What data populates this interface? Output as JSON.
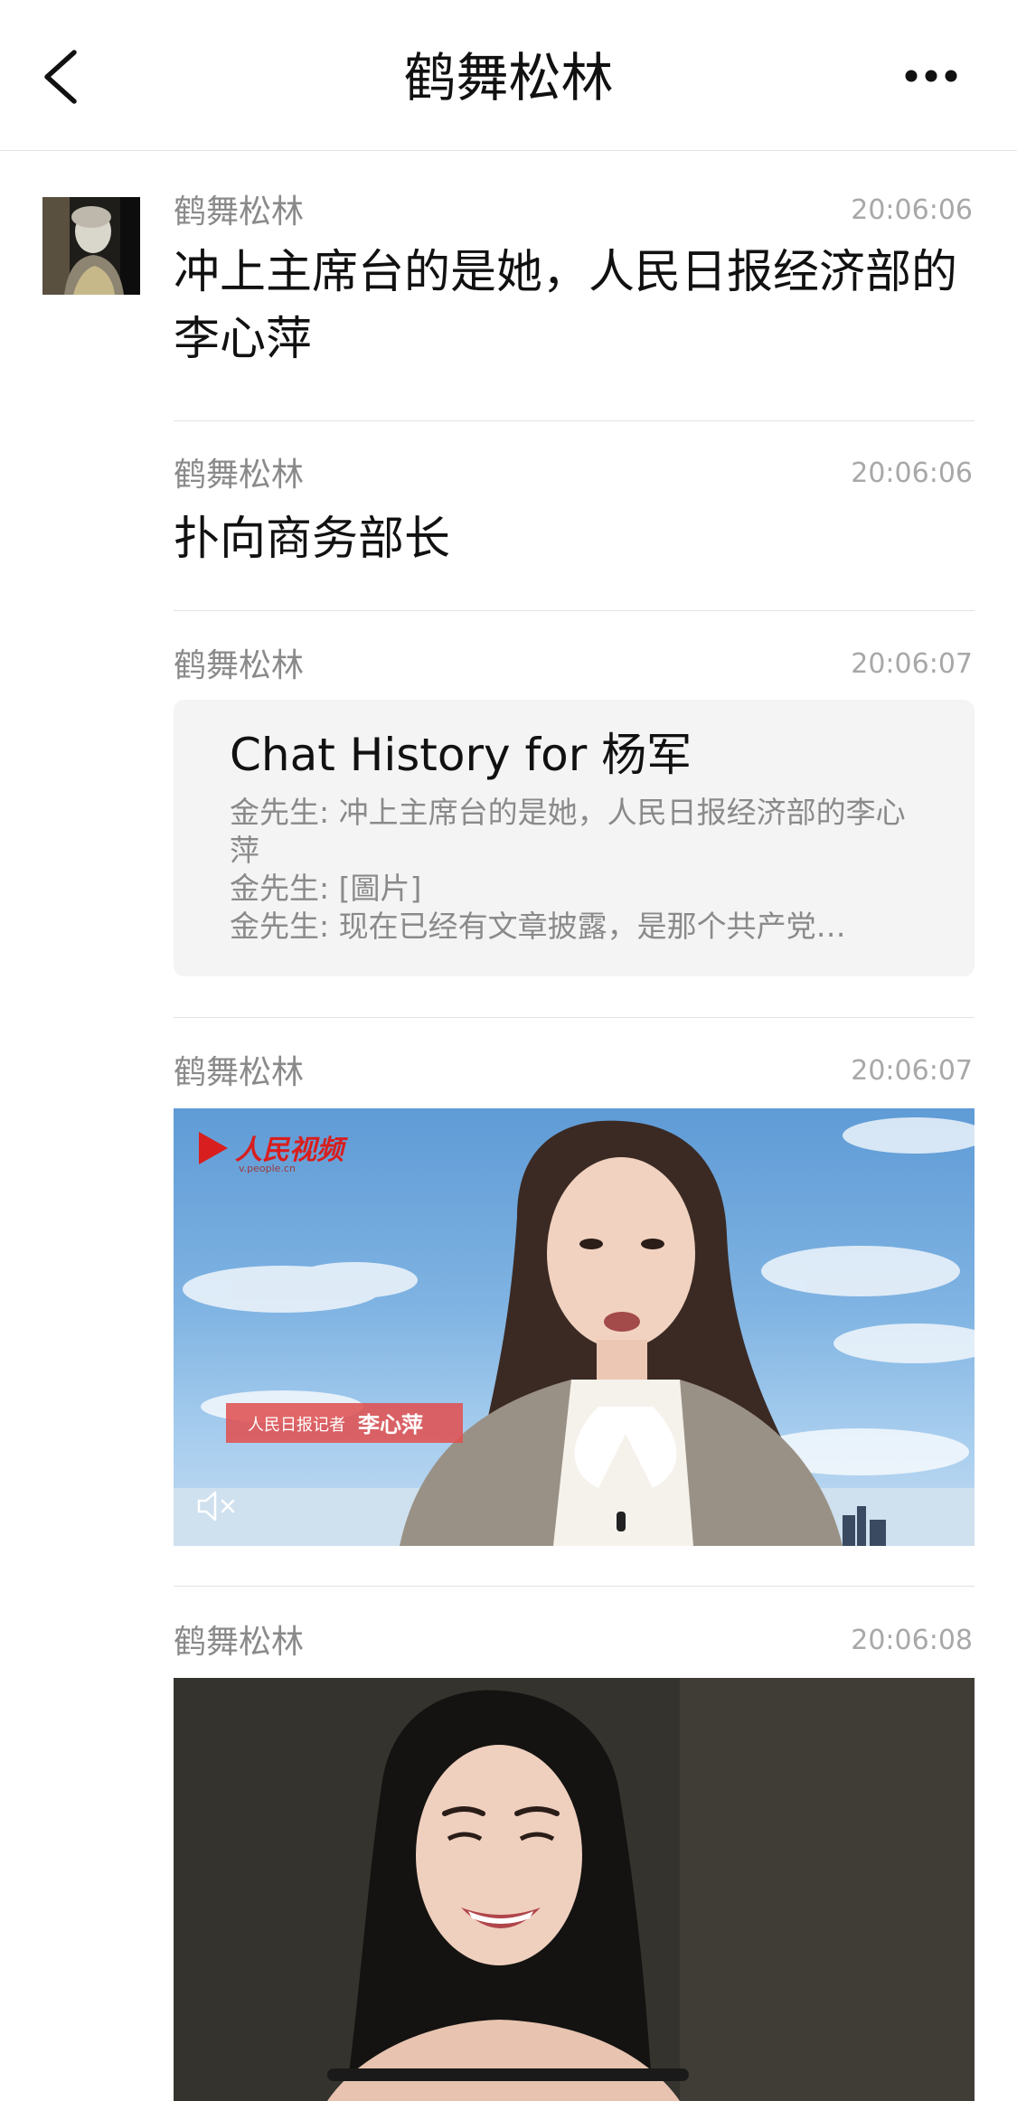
{
  "nav": {
    "title": "鹤舞松林",
    "back_icon": "chevron-left-icon",
    "more_icon": "more-dots-icon"
  },
  "messages": [
    {
      "sender": "鹤舞松林",
      "time": "20:06:06",
      "text": "冲上主席台的是她，人民日报经济部的李心萍"
    },
    {
      "sender": "鹤舞松林",
      "time": "20:06:06",
      "text": "扑向商务部长"
    },
    {
      "sender": "鹤舞松林",
      "time": "20:06:07",
      "card": {
        "title": "Chat History for 杨军",
        "lines": [
          "金先生: 冲上主席台的是她，人民日报经济部的李心萍",
          "金先生: [圖片]",
          "金先生: 现在已经有文章披露，是那个共产党…"
        ]
      }
    },
    {
      "sender": "鹤舞松林",
      "time": "20:06:07",
      "video": {
        "logo_text": "人民视频",
        "logo_sub": "v.people.cn",
        "caption_label": "人民日报记者",
        "caption_name": "李心萍",
        "mute_icon": "mute-icon"
      }
    },
    {
      "sender": "鹤舞松林",
      "time": "20:06:08",
      "photo": true
    }
  ],
  "colors": {
    "background": "#ffffff",
    "sender_gray": "#8a8a8a",
    "time_gray": "#a8a8a8",
    "card_bg": "#f4f4f4",
    "caption_red": "#e05252"
  }
}
